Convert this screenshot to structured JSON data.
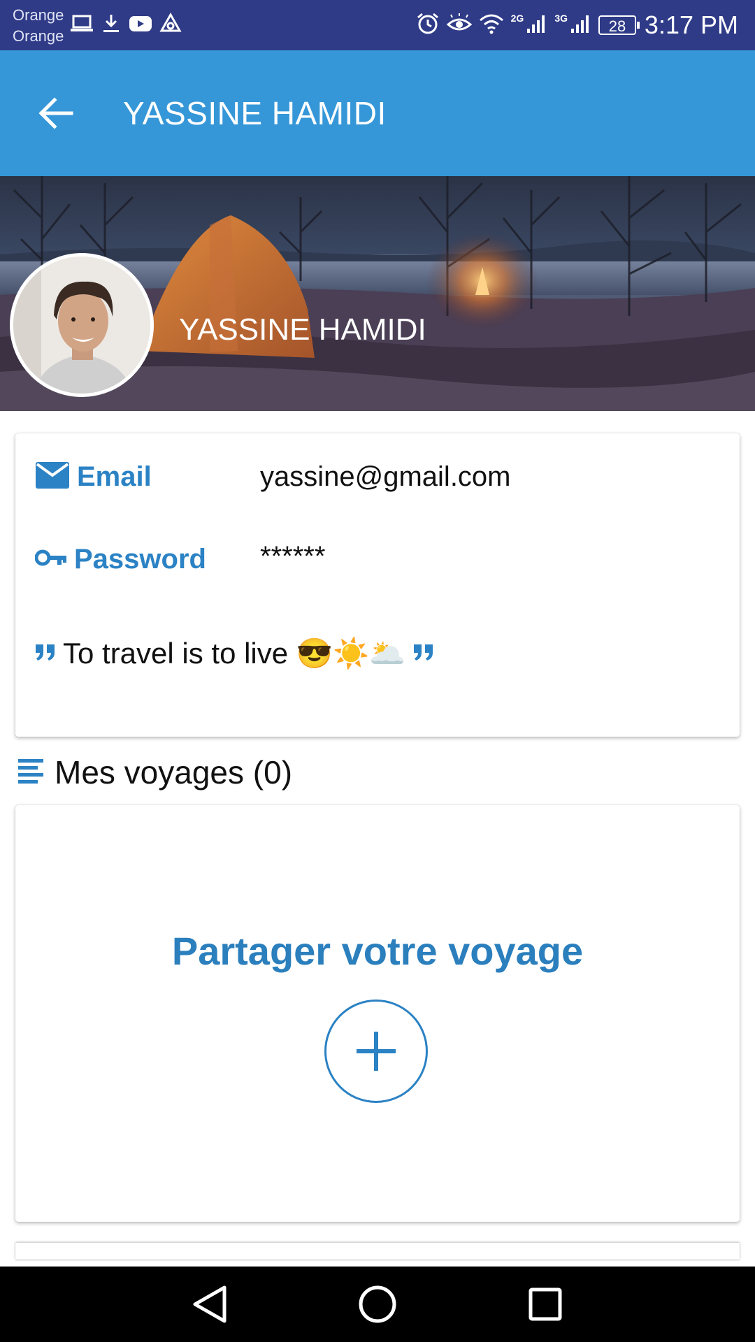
{
  "status_bar": {
    "carrier_line1": "Orange",
    "carrier_line2": "Orange",
    "net_2g": "2G",
    "net_3g": "3G",
    "battery": "28",
    "time": "3:17 PM"
  },
  "app_bar": {
    "title": "YASSINE HAMIDI"
  },
  "profile": {
    "name": "YASSINE HAMIDI"
  },
  "info": {
    "email_label": "Email",
    "email_value": "yassine@gmail.com",
    "password_label": "Password",
    "password_value": "******",
    "quote_text": "To travel is to live 😎☀️🌥️"
  },
  "trips": {
    "section_title": "Mes voyages (0)",
    "share_title": "Partager votre voyage"
  },
  "colors": {
    "status_bar": "#2f3b87",
    "app_bar": "#3597d8",
    "accent": "#2b82c4"
  }
}
